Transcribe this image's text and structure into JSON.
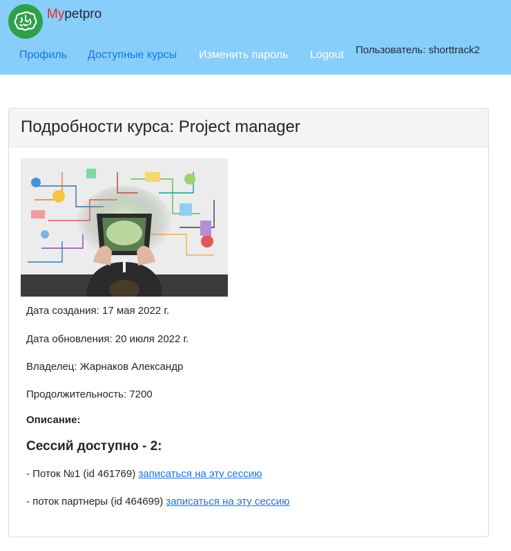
{
  "brand": {
    "part1": "My",
    "part2": "petpro"
  },
  "nav": {
    "profile": "Профиль",
    "courses": "Доступные курсы",
    "change_password": "Изменить пароль",
    "logout": "Logout"
  },
  "user_label": "Пользователь: shorttrack2",
  "course": {
    "title": "Подробности курса: Project manager",
    "created": "Дата создания: 17 мая 2022 г.",
    "updated": "Дата обновления: 20 июля 2022 г.",
    "owner": "Владелец: Жарнаков Александр",
    "duration": "Продолжительность: 7200",
    "description_label": "Описание:"
  },
  "sessions": {
    "heading": "Сессий доступно - 2:",
    "items": [
      {
        "text": "- Поток №1 (id 461769) ",
        "link": "записаться на эту сессию"
      },
      {
        "text": "- поток партнеры (id 464699) ",
        "link": "записаться на эту сессию"
      }
    ]
  },
  "colors": {
    "header_bg": "#87cefa",
    "logo_bg": "#2e9f4a",
    "brand_accent": "#e3262e",
    "link": "#1a73e8"
  }
}
